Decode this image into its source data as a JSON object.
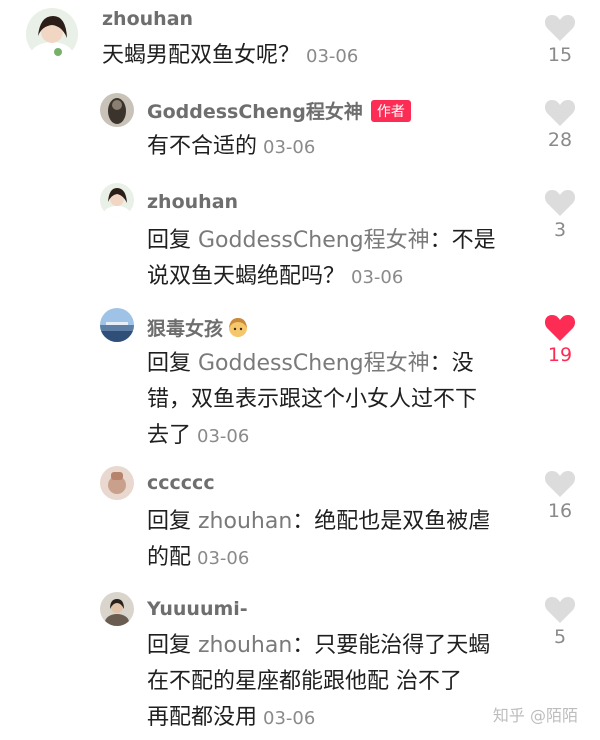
{
  "colors": {
    "like_active": "#fd2c55",
    "like_idle": "#dcdcdc",
    "badge": "#fd2c55"
  },
  "comments": [
    {
      "user": "zhouhan",
      "text": "天蝎男配双鱼女呢？",
      "time": "03-06",
      "likes": "15",
      "liked": false
    },
    {
      "user": "GoddessCheng程女神",
      "badge": "作者",
      "text": "有不合适的",
      "time": "03-06",
      "likes": "28",
      "liked": false
    },
    {
      "user": "zhouhan",
      "reply_prefix": "回复 ",
      "reply_to": "GoddessCheng程女神",
      "reply_sep": "：",
      "line1_text": "不是",
      "line2_text": "说双鱼天蝎绝配吗？",
      "time": "03-06",
      "likes": "3",
      "liked": false
    },
    {
      "user": "狠毒女孩",
      "reply_prefix": "回复 ",
      "reply_to": "GoddessCheng程女神",
      "reply_sep": "：",
      "line1_text": "没",
      "line2_text": "错，双鱼表示跟这个小女人过不下",
      "line3_text": "去了",
      "time": "03-06",
      "likes": "19",
      "liked": true
    },
    {
      "user": "cccccc",
      "reply_prefix": "回复 ",
      "reply_to": "zhouhan",
      "reply_sep": "：",
      "line1_text": "绝配也是双鱼被虐",
      "line2_text": "的配",
      "time": "03-06",
      "likes": "16",
      "liked": false
    },
    {
      "user": "Yuuuumi-",
      "reply_prefix": "回复 ",
      "reply_to": "zhouhan",
      "reply_sep": "：",
      "line1_text": "只要能治得了天蝎",
      "line2_text": "在不配的星座都能跟他配 治不了",
      "line3_text": "再配都没用",
      "time": "03-06",
      "likes": "5",
      "liked": false
    }
  ],
  "watermark": "知乎 @陌陌"
}
